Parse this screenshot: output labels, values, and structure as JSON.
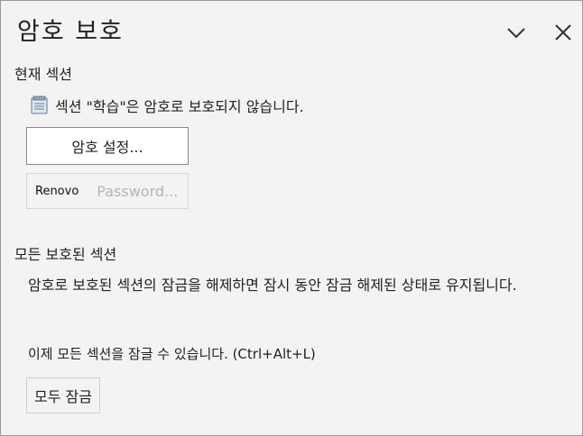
{
  "pane": {
    "title": "암호   보호",
    "icons": {
      "collapse": "chevron-down-icon",
      "close": "close-icon"
    }
  },
  "current_section": {
    "heading": "현재 섹션",
    "status_icon": "notebook-section-icon",
    "status_text": "섹션 \"학습\"은 암호로 보호되지 않습니다.",
    "set_password_label": "암호 설정...",
    "remove_password_prefix": "Renovo",
    "remove_password_label": "Password..."
  },
  "all_protected": {
    "heading": "모든 보호된 섹션",
    "description": "암호로 보호된 섹션의 잠금을 해제하면 잠시 동안 잠금 해제된 상태로 유지됩니다.",
    "lock_hint": "이제 모든 섹션을 잠글 수 있습니다. (Ctrl+Alt+L)",
    "lock_all_label": "모두 잠금"
  },
  "colors": {
    "pane_bg": "#f3f3f3",
    "button_bg": "#ffffff",
    "disabled_text": "#b5b5b5"
  }
}
